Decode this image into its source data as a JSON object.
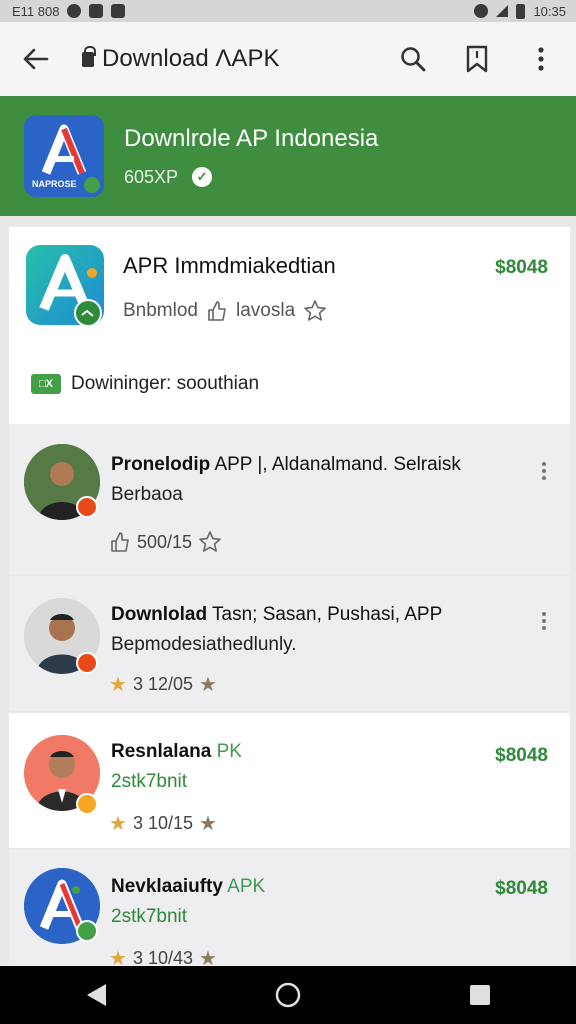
{
  "status_bar": {
    "left_text": "E11 808",
    "time": "10:35"
  },
  "toolbar": {
    "title": "Download ɅAPK"
  },
  "banner": {
    "title": "Downlrole AP Indonesia",
    "subtitle": "605XP",
    "logo_text": "NAPROSE"
  },
  "top_card": {
    "title": "APR Immdmiakedtian",
    "price": "$8048",
    "meta_text": "Bnbmlod",
    "meta_text_2": "lavosla",
    "status_chip": "□X",
    "status_text": "Dowininger: soouthian"
  },
  "list": [
    {
      "title_bold": "Pronelodip",
      "title_rest": " APP |, Aldanalmand. Selraisk",
      "sub": "Berbaoa",
      "meta": "500/15"
    },
    {
      "title_bold": "Downlolad",
      "title_rest": " Tasn; Sasan, Pushasi, APP",
      "sub": "Bepmodesiathedlunly.",
      "meta": "3 12/05"
    },
    {
      "title_bold": "Resnlalana",
      "title_suffix": " PK",
      "sub": "2stk7bnit",
      "meta": "3 10/15",
      "price": "$8048"
    },
    {
      "title_bold": "Nevklaaiufty",
      "title_suffix": " APK",
      "sub": "2stk7bnit",
      "meta": "3 10/43",
      "price": "$8048"
    }
  ],
  "colors": {
    "brand_green": "#3f8e3f",
    "price_green": "#2f8b39",
    "logo_blue": "#2b63c7"
  },
  "icons": [
    "back-arrow-icon",
    "lock-icon",
    "search-icon",
    "bookmark-icon",
    "more-vert-icon",
    "verified-check-icon",
    "thumbs-up-icon",
    "star-icon",
    "nav-back-icon",
    "nav-home-icon",
    "nav-recents-icon"
  ]
}
